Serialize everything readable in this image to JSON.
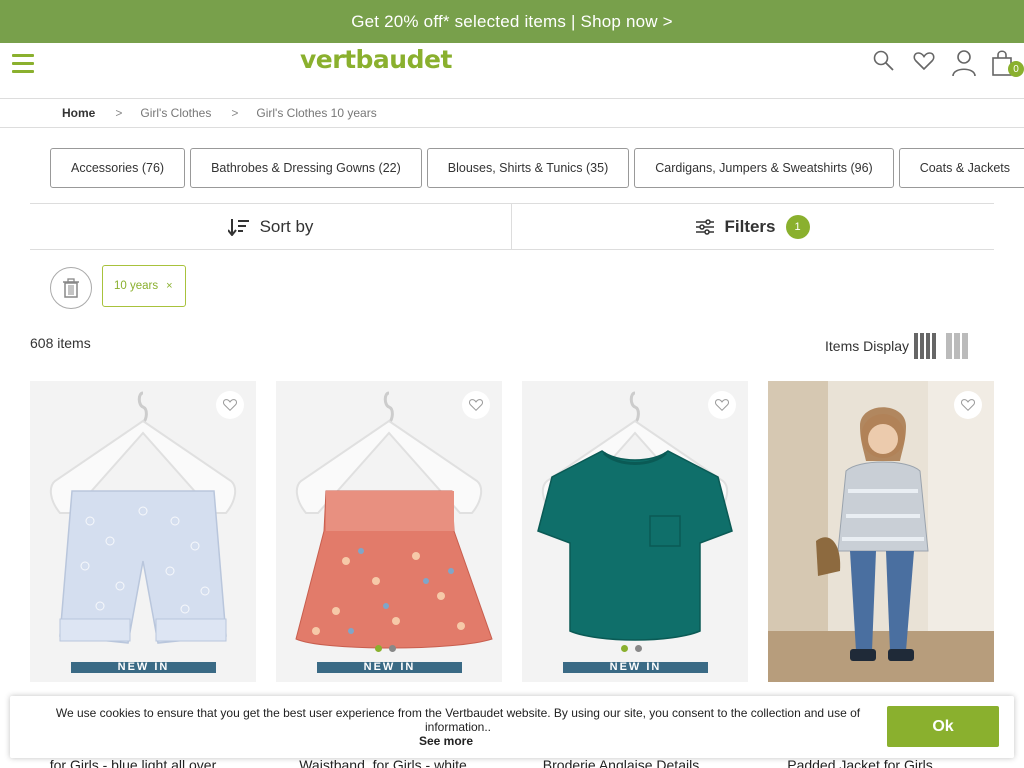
{
  "promo": {
    "text": "Get 20% off* selected items | Shop now >"
  },
  "header": {
    "logo": "vertbaudet",
    "basket_count": "0",
    "brand_color": "#8ab02e",
    "promo_color": "#78a04b"
  },
  "breadcrumb": {
    "items": [
      "Home",
      "Girl's Clothes",
      "Girl's Clothes 10 years"
    ],
    "separator": ">"
  },
  "categories": [
    "Accessories (76)",
    "Bathrobes & Dressing Gowns (22)",
    "Blouses, Shirts & Tunics (35)",
    "Cardigans, Jumpers & Sweatshirts (96)",
    "Coats & Jackets"
  ],
  "toolbar": {
    "sort_label": "Sort by",
    "filters_label": "Filters",
    "filters_count": "1"
  },
  "active_filters": {
    "items": [
      {
        "label": "10 years",
        "remove": "×"
      }
    ]
  },
  "results": {
    "count": "608 items",
    "display_label": "Items Display"
  },
  "products": [
    {
      "title": "for Girls - blue light all over",
      "new_label": "NEW IN",
      "image": "light blue floral denim shorts on hanger",
      "colors": []
    },
    {
      "title": "Waistband, for Girls - white",
      "new_label": "NEW IN",
      "image": "red floral smocked skirt on hanger",
      "colors": [
        "#8ab02e",
        "#888888"
      ]
    },
    {
      "title": "Broderie Anglaise Details",
      "new_label": "NEW IN",
      "image": "teal t-shirt with frill sleeves on hanger",
      "colors": [
        "#8ab02e",
        "#888888"
      ]
    },
    {
      "title": "Padded Jacket for Girls",
      "new_label": "",
      "image": "girl wearing silver padded jacket",
      "colors": []
    }
  ],
  "cookie": {
    "message": "We use cookies to ensure that you get the best user experience from the Vertbaudet website. By using our site, you consent to the collection and use of information..",
    "see_more": "See more",
    "ok": "Ok"
  }
}
